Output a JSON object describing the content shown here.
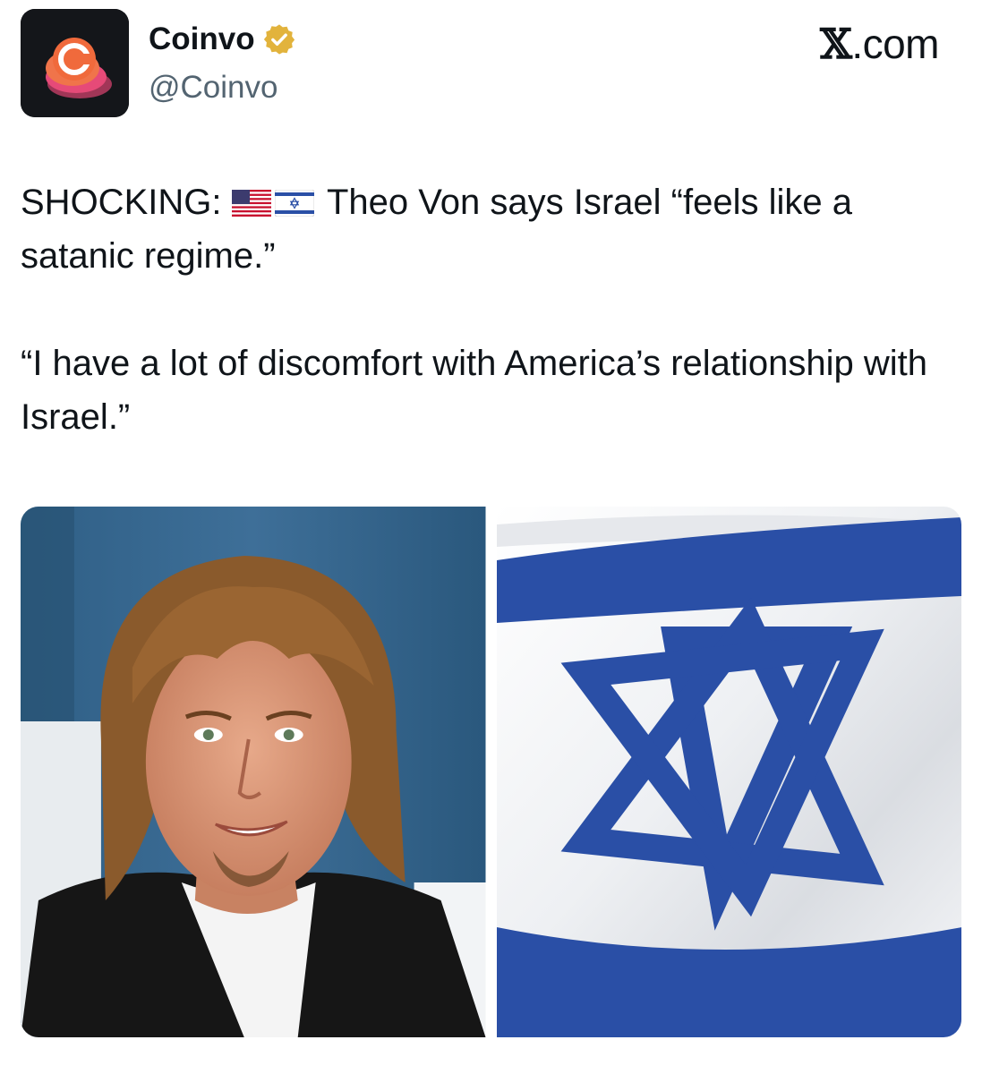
{
  "author": {
    "avatar_icon": "coinvo-logo-icon",
    "display_name": "Coinvo",
    "verified_icon": "verified-badge-icon",
    "handle": "@Coinvo"
  },
  "brand": {
    "logo": "𝕏",
    "domain": ".com"
  },
  "tweet": {
    "lead": "SHOCKING:",
    "flags": [
      "us-flag-icon",
      "israel-flag-icon"
    ],
    "line1_rest": "Theo Von says Israel “feels like a satanic regime.”",
    "quote": "“I have a lot of discomfort with America’s relationship with Israel.”"
  },
  "media": [
    {
      "name": "photo-of-man"
    },
    {
      "name": "israel-flag-photo"
    }
  ],
  "colors": {
    "flag_blue": "#2a4fa6",
    "badge_gold": "#e2b33c",
    "avatar_orange": "#f06a3c",
    "avatar_pink": "#e64a78"
  }
}
